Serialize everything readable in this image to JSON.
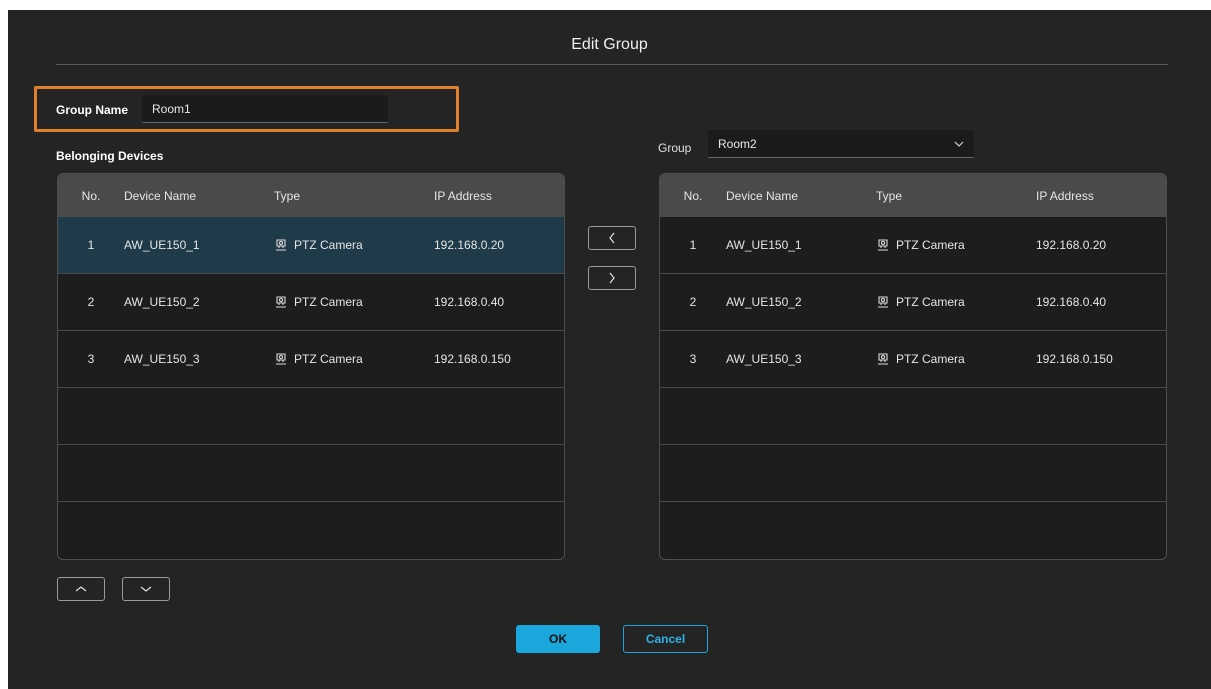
{
  "dialog": {
    "title": "Edit Group"
  },
  "group_name": {
    "label": "Group Name",
    "value": "Room1"
  },
  "belonging_label": "Belonging Devices",
  "group_select": {
    "label": "Group",
    "value": "Room2"
  },
  "columns": {
    "no": "No.",
    "name": "Device Name",
    "type": "Type",
    "ip": "IP Address"
  },
  "left_table": {
    "rows": [
      {
        "no": "1",
        "name": "AW_UE150_1",
        "type": "PTZ Camera",
        "ip": "192.168.0.20",
        "selected": true
      },
      {
        "no": "2",
        "name": "AW_UE150_2",
        "type": "PTZ Camera",
        "ip": "192.168.0.40",
        "selected": false
      },
      {
        "no": "3",
        "name": "AW_UE150_3",
        "type": "PTZ Camera",
        "ip": "192.168.0.150",
        "selected": false
      },
      {
        "no": "",
        "name": "",
        "type": "",
        "ip": "",
        "selected": false
      },
      {
        "no": "",
        "name": "",
        "type": "",
        "ip": "",
        "selected": false
      },
      {
        "no": "",
        "name": "",
        "type": "",
        "ip": "",
        "selected": false
      }
    ]
  },
  "right_table": {
    "rows": [
      {
        "no": "1",
        "name": "AW_UE150_1",
        "type": "PTZ Camera",
        "ip": "192.168.0.20",
        "selected": false
      },
      {
        "no": "2",
        "name": "AW_UE150_2",
        "type": "PTZ Camera",
        "ip": "192.168.0.40",
        "selected": false
      },
      {
        "no": "3",
        "name": "AW_UE150_3",
        "type": "PTZ Camera",
        "ip": "192.168.0.150",
        "selected": false
      },
      {
        "no": "",
        "name": "",
        "type": "",
        "ip": "",
        "selected": false
      },
      {
        "no": "",
        "name": "",
        "type": "",
        "ip": "",
        "selected": false
      },
      {
        "no": "",
        "name": "",
        "type": "",
        "ip": "",
        "selected": false
      }
    ]
  },
  "buttons": {
    "ok": "OK",
    "cancel": "Cancel"
  },
  "icons": {
    "row_type": "ptz-camera-icon",
    "move_left": "chevron-left-icon",
    "move_right": "chevron-right-icon",
    "move_up": "chevron-up-icon",
    "move_down": "chevron-down-icon",
    "select_dropdown": "chevron-down-icon"
  },
  "colors": {
    "background": "#242424",
    "accent": "#1aa7dc",
    "highlight_frame": "#e07f2c",
    "selected_row": "#1f3a48",
    "table_header": "#4a4a4a"
  }
}
